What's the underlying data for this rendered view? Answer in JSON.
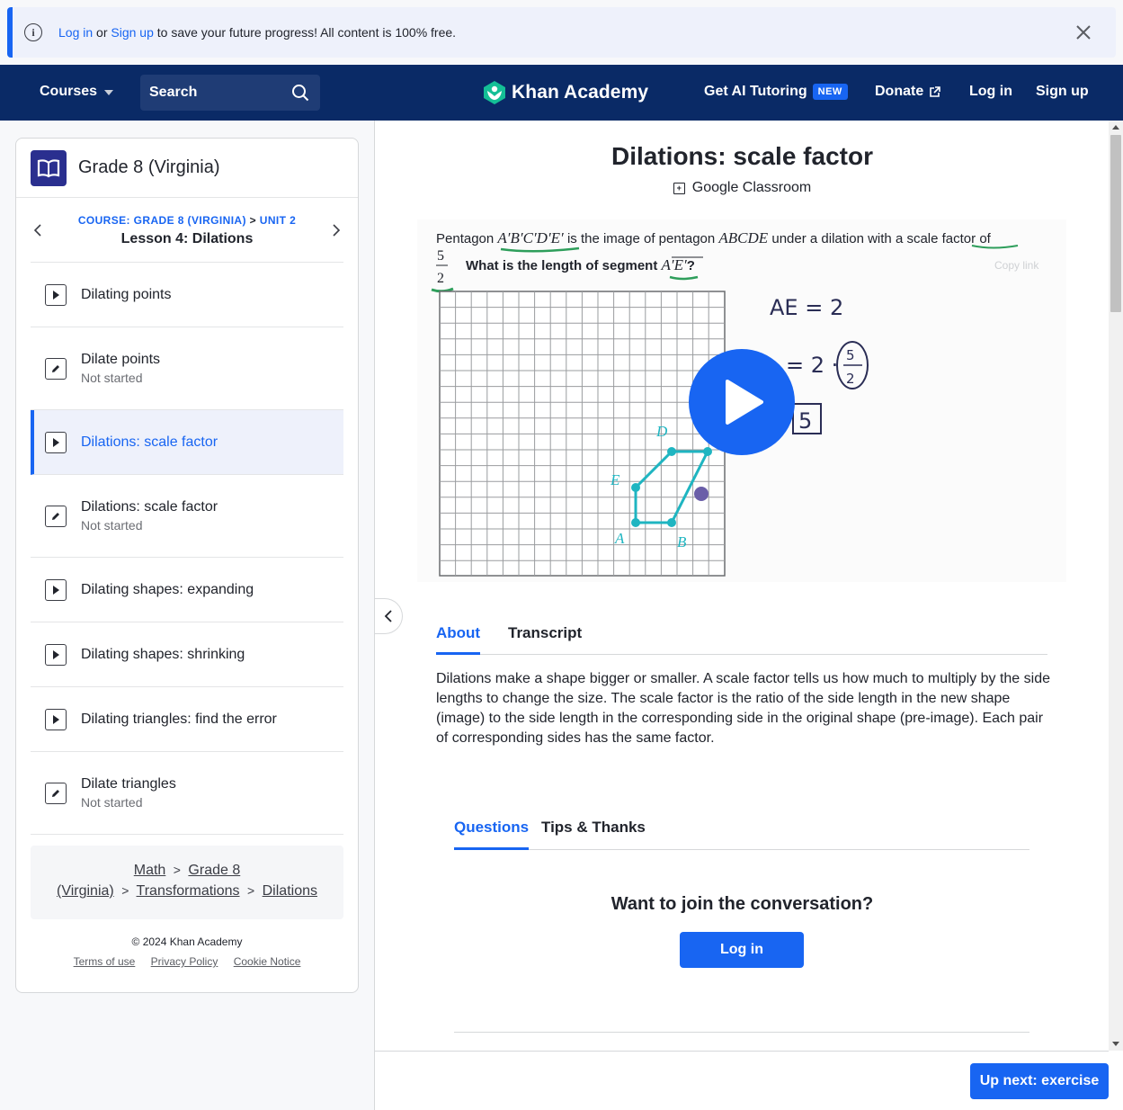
{
  "banner": {
    "login": "Log in",
    "or": " or ",
    "signup": "Sign up",
    "message": " to save your future progress! All content is 100% free."
  },
  "nav": {
    "courses": "Courses",
    "search": "Search",
    "brand": "Khan Academy",
    "ai_tutoring": "Get AI Tutoring",
    "new_badge": "NEW",
    "donate": "Donate",
    "login": "Log in",
    "signup": "Sign up"
  },
  "sidebar": {
    "course_title": "Grade 8 (Virginia)",
    "crumb_course": "COURSE: GRADE 8 (VIRGINIA)",
    "crumb_sep": " > ",
    "crumb_unit": "UNIT 2",
    "lesson_title": "Lesson 4: Dilations",
    "items": [
      {
        "label": "Dilating points",
        "sub": ""
      },
      {
        "label": "Dilate points",
        "sub": "Not started"
      },
      {
        "label": "Dilations: scale factor",
        "sub": ""
      },
      {
        "label": "Dilations: scale factor",
        "sub": "Not started"
      },
      {
        "label": "Dilating shapes: expanding",
        "sub": ""
      },
      {
        "label": "Dilating shapes: shrinking",
        "sub": ""
      },
      {
        "label": "Dilating triangles: find the error",
        "sub": ""
      },
      {
        "label": "Dilate triangles",
        "sub": "Not started"
      }
    ],
    "breadcrumb": {
      "math": "Math",
      "grade_a": "Grade 8",
      "grade_b": "(Virginia)",
      "transformations": "Transformations",
      "dilations": "Dilations",
      "gt": ">"
    },
    "copyright": "© 2024 Khan Academy",
    "terms": "Terms of use",
    "privacy": "Privacy Policy",
    "cookie": "Cookie Notice"
  },
  "main": {
    "title": "Dilations: scale factor",
    "classroom": "Google Classroom",
    "video": {
      "q_prefix": "Pentagon ",
      "q_image": "A′B′C′D′E′",
      "q_mid": " is the image of pentagon ",
      "q_pre": "ABCDE",
      "q_end": " under a dilation with a scale factor of",
      "frac_num": "5",
      "frac_den": "2",
      "question": "What is the length of segment ",
      "segment": "A′E′",
      "qmark": "?",
      "copy_link": "Copy link",
      "hw_ae": "AE = 2",
      "hw_calc": "= 2 ·",
      "hw_answer": "5",
      "labels": {
        "A": "A",
        "B": "B",
        "D": "D",
        "E": "E"
      }
    },
    "tab_about": "About",
    "tab_transcript": "Transcript",
    "about_text": "Dilations make a shape bigger or smaller. A scale factor tells us how much to multiply by the side lengths to change the size. The scale factor is the ratio of the side length in the new shape (image) to the side length in the corresponding side in the original shape (pre-image). Each pair of corresponding sides has the same factor.",
    "tab_questions": "Questions",
    "tab_tips": "Tips & Thanks",
    "join": "Want to join the conversation?",
    "login_btn": "Log in",
    "up_next": "Up next: exercise"
  }
}
